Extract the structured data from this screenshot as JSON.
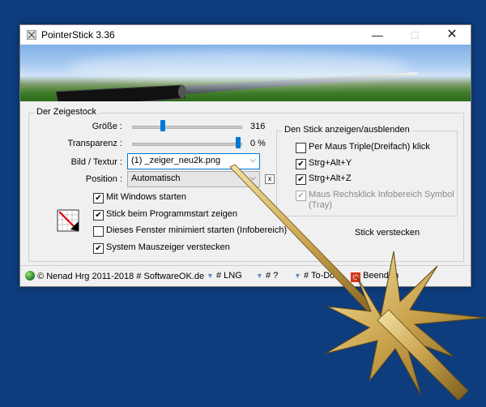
{
  "window": {
    "title": "PointerStick 3.36"
  },
  "group_main": {
    "label": "Der Zeigestock"
  },
  "size": {
    "label": "Größe :",
    "value": "316",
    "fraction": 0.28
  },
  "transparency": {
    "label": "Transparenz :",
    "value": "0 %",
    "fraction": 0.98
  },
  "texture": {
    "label": "Bild / Textur :",
    "selected": "(1) _zeiger_neu2k.png"
  },
  "position": {
    "label": "Position :",
    "selected": "Automatisch",
    "x_label": "x"
  },
  "options": [
    {
      "label": "Mit Windows starten",
      "checked": true
    },
    {
      "label": "Stick beim Programmstart zeigen",
      "checked": true
    },
    {
      "label": "Dieses Fenster minimiert starten (Infobereich)",
      "checked": false
    },
    {
      "label": "System Mauszeiger verstecken",
      "checked": true
    }
  ],
  "group_toggle": {
    "label": "Den Stick anzeigen/ausblenden",
    "items": [
      {
        "label": "Per Maus Triple(Dreifach) klick",
        "checked": false,
        "enabled": true
      },
      {
        "label": "Strg+Alt+Y",
        "checked": true,
        "enabled": true
      },
      {
        "label": "Strg+Alt+Z",
        "checked": true,
        "enabled": true
      },
      {
        "label": "Maus Rechsklick Infobereich Symbol",
        "label2": "(Tray)",
        "checked": true,
        "enabled": false
      }
    ]
  },
  "hide_stick": "Stick verstecken",
  "statusbar": {
    "copyright": "© Nenad Hrg 2011-2018 # SoftwareOK.de",
    "lng": "# LNG",
    "help": "# ?",
    "todo": "# To-Do",
    "exit": "Beenden"
  },
  "colors": {
    "desktop": "#0e3d7e",
    "accent": "#0078d7"
  }
}
